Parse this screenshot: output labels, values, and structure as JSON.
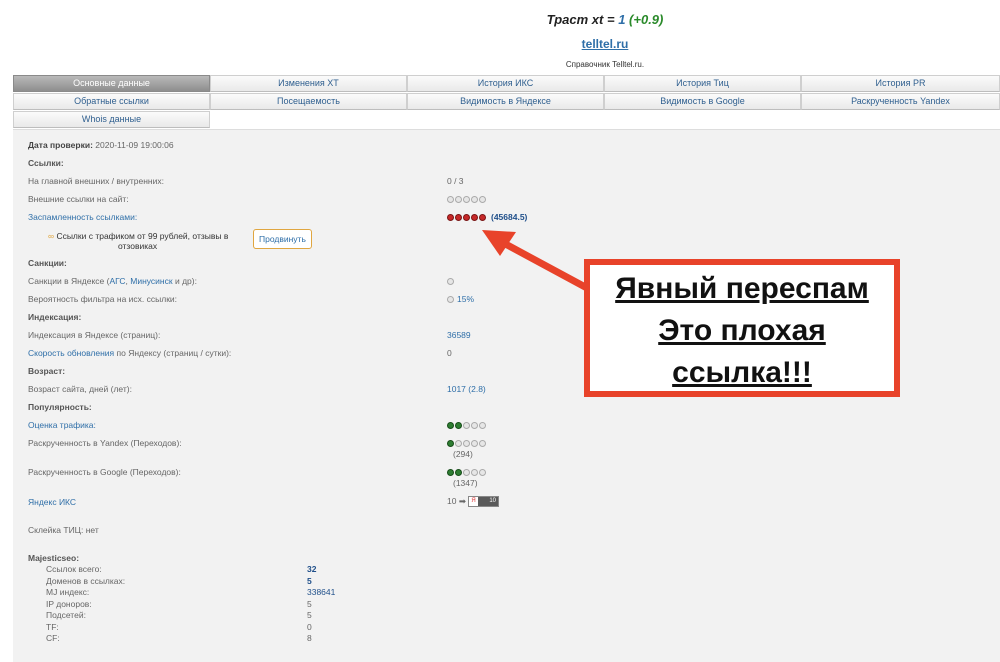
{
  "header": {
    "title_prefix": "Траст xt = ",
    "trust_value": "1",
    "trust_delta": "(+0.9)",
    "site_link": "telltel.ru",
    "subtitle": "Справочник Telltel.ru."
  },
  "tabs_row1": [
    "Основные данные",
    "Изменения XT",
    "История ИКС",
    "История Тиц",
    "История PR"
  ],
  "tabs_row2": [
    "Обратные ссылки",
    "Посещаемость",
    "Видимость в Яндексе",
    "Видимость в Google",
    "Раскрученность Yandex"
  ],
  "tabs_row3": [
    "Whois данные"
  ],
  "main": {
    "check_date_label": "Дата проверки:",
    "check_date_value": "2020-11-09 19:00:06",
    "links_section": "Ссылки:",
    "main_links_label": "На главной внешних / внутренних:",
    "main_links_value": "0 / 3",
    "external_links_label": "Внешние ссылки на сайт:",
    "spam_label": "Заспамленность ссылками:",
    "spam_value": "(45684.5)",
    "promo_text_1": "Ссылки с трафиком от 99 рублей, отзывы в",
    "promo_text_2": "отзовиках",
    "promo_button": "Продвинуть",
    "sanctions_section": "Санкции:",
    "yandex_sanctions_prefix": "Санкции в Яндексе (",
    "ags_link": "АГС",
    "comma": ", ",
    "minusinsk_link": "Минусинск",
    "yandex_sanctions_suffix": " и др):",
    "filter_prob_label": "Вероятность фильтра на исх. ссылки:",
    "filter_prob_value": "15%",
    "indexing_section": "Индексация:",
    "yandex_index_label": "Индексация в Яндексе (страниц):",
    "yandex_index_value": "36589",
    "speed_link": "Скорость обновления",
    "speed_suffix": " по Яндексу (страниц / сутки):",
    "speed_value": "0",
    "age_section": "Возраст:",
    "age_label": "Возраст сайта, дней (лет):",
    "age_value": "1017 (2.8)",
    "popularity_section": "Популярность:",
    "traffic_link": "Оценка трафика:",
    "yandex_promo_label": "Раскрученность в Yandex (Переходов):",
    "yandex_promo_value": "(294)",
    "google_promo_label": "Раскрученность в Google (Переходов):",
    "google_promo_value": "(1347)",
    "iks_link": "Яндекс ИКС",
    "iks_value": "10",
    "iks_badge_left": "Я",
    "iks_badge_right": "10",
    "tic_glue": "Склейка ТИЦ: нет",
    "majestic_section": "Majesticseo:",
    "majestic_rows": [
      {
        "label": "Ссылок всего:",
        "value": "32"
      },
      {
        "label": "Доменов в ссылках:",
        "value": "5"
      },
      {
        "label": "MJ индекс:",
        "value": "338641"
      },
      {
        "label": "IP доноров:",
        "value": "5"
      },
      {
        "label": "Подсетей:",
        "value": "5"
      },
      {
        "label": "TF:",
        "value": "0"
      },
      {
        "label": "CF:",
        "value": "8"
      }
    ]
  },
  "callout": {
    "line1": "Явный переспам",
    "line2": "Это плохая",
    "line3": "ссылка!!!"
  },
  "colors": {
    "link": "#2f6fa8",
    "callout_border": "#e8432a",
    "red_dot": "#c62828",
    "green_dot": "#2e7d32"
  }
}
